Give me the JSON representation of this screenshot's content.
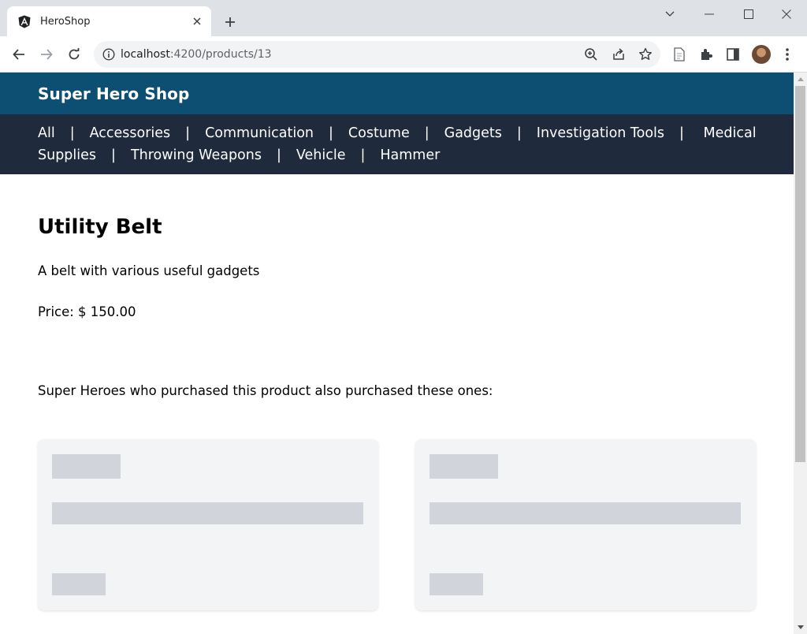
{
  "browser": {
    "tab_title": "HeroShop",
    "url_host": "localhost",
    "url_path": ":4200/products/13"
  },
  "app": {
    "title": "Super Hero Shop",
    "categories": [
      "All",
      "Accessories",
      "Communication",
      "Costume",
      "Gadgets",
      "Investigation Tools",
      "Medical Supplies",
      "Throwing Weapons",
      "Vehicle",
      "Hammer"
    ],
    "separator": "|"
  },
  "product": {
    "name": "Utility Belt",
    "description": "A belt with various useful gadgets",
    "price_text": "Price: $ 150.00"
  },
  "related": {
    "heading": "Super Heroes who purchased this product also purchased these ones:"
  },
  "colors": {
    "header_bg": "#0c4f73",
    "nav_bg": "#1f2a3c",
    "card_bg": "#f3f4f6",
    "skeleton": "#d1d5db"
  }
}
